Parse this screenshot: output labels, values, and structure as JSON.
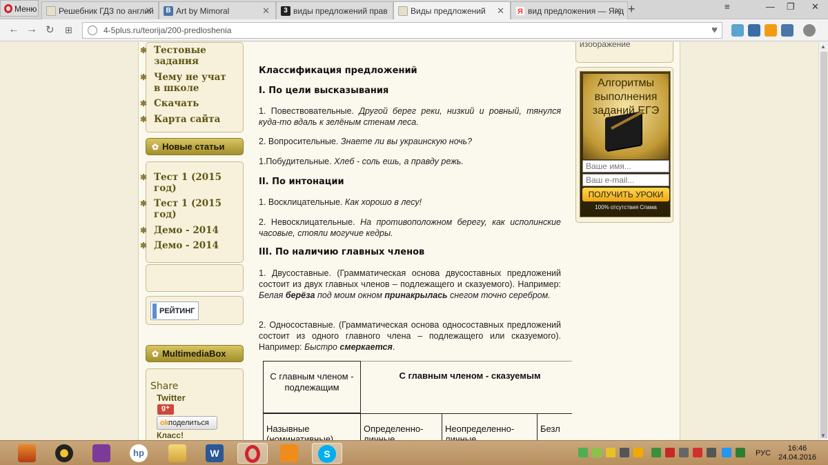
{
  "browser": {
    "menu_label": "Меню",
    "tabs": [
      {
        "title": "Решебник ГДЗ по англий",
        "favicon_color": "#e8e0c6"
      },
      {
        "title": "Art by Mimoral",
        "favicon_color": "#4a76a8"
      },
      {
        "title": "виды предложений прав",
        "favicon_color": "#222222"
      },
      {
        "title": "Виды предложений",
        "favicon_color": "#e8e0c6"
      },
      {
        "title": "вид предложения — Янд",
        "favicon_color": "#ff3333"
      }
    ],
    "new_tab": "+",
    "url": "4-5plus.ru/teorija/200-predloshenia"
  },
  "sidebar": {
    "menu_items": [
      "Тестовые задания",
      "Чему не учат в школе",
      "Скачать",
      "Карта сайта"
    ],
    "new_articles_title": "Новые статьи",
    "new_articles": [
      "Тест 1 (2015 год)",
      "Тест 1 (2015 год)",
      "Демо - 2014",
      "Демо - 2014"
    ],
    "rating_label": "РЕЙТИНГ",
    "multimedia_title": "MultimediaBox",
    "share_title": "Share",
    "share_twitter": "Twitter",
    "share_button": "поделиться",
    "share_classmates": "Класс!"
  },
  "content": {
    "title": "Классификация предложений",
    "section1": "I. По цели высказывания",
    "s1_item1_label": "1. Повествовательные.",
    "s1_item1_example": "Другой берег реки, низкий и ровный, тянулся куда-то вдаль к зелёным стенам леса.",
    "s1_item2_label": "2. Вопросительные.",
    "s1_item2_example": "Знаете ли вы украинскую ночь?",
    "s1_item3_label": "1.Побудительные.",
    "s1_item3_example": "Хлеб - соль ешь, а правду режь.",
    "section2": "II. По интонации",
    "s2_item1_label": "1. Восклицательные.",
    "s2_item1_example": "Как хорошо в лесу!",
    "s2_item2_label": "2. Невосклицательные.",
    "s2_item2_example": "На противоположном берегу, как исполинские часовые, стояли могучие кедры.",
    "section3": "III. По наличию главных членов",
    "s3_item1_text": "1. Двусоставные. (Грамматическая основа двусоставных предложений состоит из двух главных членов – подлежащего и сказуемого). Например:",
    "s3_item1_ex_a": "Белая",
    "s3_item1_ex_b": "берёза",
    "s3_item1_ex_c": "под моим окном",
    "s3_item1_ex_d": "принакрылась",
    "s3_item1_ex_e": "снегом точно серебром.",
    "s3_item2_text": "2. Односоставные. (Грамматическая основа односоставных предложений состоит из одного главного члена – подлежащего или сказуемого). Например:",
    "s3_item2_ex_a": "Быстро",
    "s3_item2_ex_b": "смеркается",
    "s3_item2_end": "."
  },
  "table": {
    "head_subject": "С главным членом - подлежащим",
    "head_predicate": "С главным членом - сказуемым",
    "row_cells": [
      "Назывные (номинативные)",
      "Определенно-личные",
      "Неопределенно-личные",
      "Безл"
    ]
  },
  "right_column": {
    "top_text": "изображение",
    "ad_title": "Алгоритмы выполнения заданий ЕГЭ",
    "name_placeholder": "Ваше имя...",
    "email_placeholder": "Ваш e-mail...",
    "button": "ПОЛУЧИТЬ УРОКИ",
    "note": "100% отсутствия Спама"
  },
  "taskbar": {
    "language": "РУС",
    "time": "16:46",
    "date": "24.04.2016"
  }
}
